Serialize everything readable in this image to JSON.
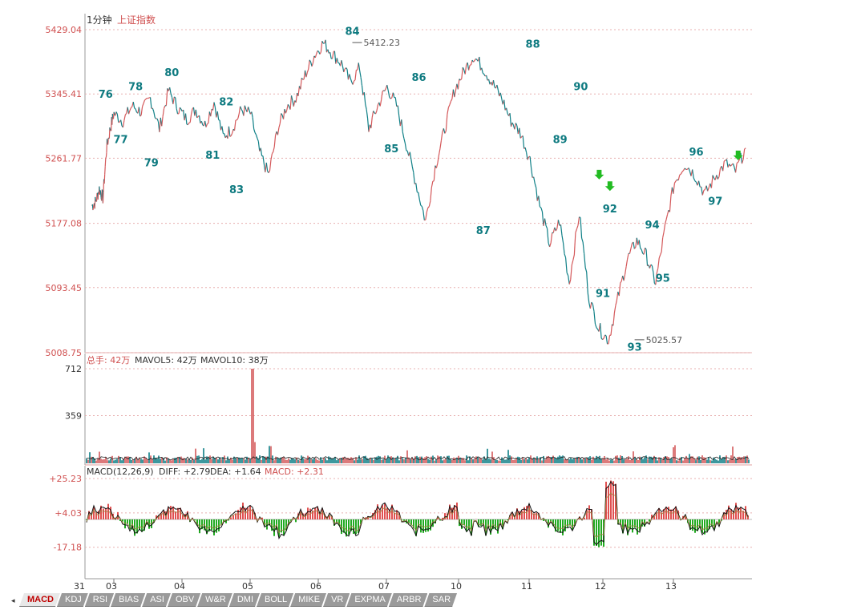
{
  "header": {
    "period": "1分钟",
    "instrument": "上证指数"
  },
  "price_axis": {
    "ticks": [
      "5429.04",
      "5345.41",
      "5261.77",
      "5177.08",
      "5093.45",
      "5008.75"
    ]
  },
  "volume_panel": {
    "label": "总手: 42万",
    "mavol5": "MAVOL5: 42万",
    "mavol10": "MAVOL10: 38万",
    "ticks": [
      "712",
      "359"
    ]
  },
  "macd_panel": {
    "label": "MACD(12,26,9)",
    "diff": "DIFF: +2.79",
    "dea": "DEA: +1.64",
    "macd": "MACD: +2.31",
    "ticks": [
      "+25.23",
      "+4.03",
      "-17.18"
    ]
  },
  "time_axis": {
    "labels": [
      "31",
      "03",
      "04",
      "05",
      "06",
      "07",
      "10",
      "11",
      "12",
      "13"
    ]
  },
  "indicator_tabs": [
    "MACD",
    "KDJ",
    "RSI",
    "BIAS",
    "ASI",
    "OBV",
    "W&R",
    "DMI",
    "BOLL",
    "MIKE",
    "VR",
    "EXPMA",
    "ARBR",
    "SAR"
  ],
  "colors": {
    "up": "#d4585a",
    "down": "#0e7f86",
    "price_axis_text": "#d05050",
    "wave_label": "#0e7a80",
    "macd_positive": "#e05050",
    "macd_negative": "#22aa22",
    "arrow": "#22bb22",
    "panel_border": "#e0a0a0"
  },
  "chart_data": {
    "type": "line",
    "title": "1分钟 上证指数",
    "ylim": [
      5008.75,
      5429.04
    ],
    "x": [
      "31",
      "03",
      "04",
      "05",
      "06",
      "07",
      "10",
      "11",
      "12",
      "13"
    ],
    "series": [
      {
        "values": [
          5200,
          5205,
          5222,
          5210,
          5275,
          5300,
          5320,
          5310,
          5330,
          5322,
          5340,
          5300,
          5350,
          5328,
          5312,
          5325,
          5305,
          5335,
          5290,
          5300,
          5325,
          5320,
          5270,
          5240,
          5300,
          5330,
          5340,
          5370,
          5395,
          5412,
          5398,
          5385,
          5360,
          5380,
          5300,
          5330,
          5355,
          5330,
          5280,
          5230,
          5180,
          5250,
          5300,
          5350,
          5375,
          5395,
          5380,
          5360,
          5340,
          5310,
          5295,
          5260,
          5200,
          5150,
          5180,
          5100,
          5190,
          5080,
          5040,
          5025,
          5080,
          5130,
          5155,
          5135,
          5100,
          5170,
          5230,
          5255,
          5240,
          5215,
          5238,
          5255,
          5245,
          5275
        ]
      }
    ],
    "wave_labels": [
      {
        "label": "76",
        "x": 0.7,
        "price": 5330,
        "pos": "above"
      },
      {
        "label": "77",
        "x": 1.1,
        "price": 5300,
        "pos": "below"
      },
      {
        "label": "78",
        "x": 1.32,
        "price": 5340,
        "pos": "above"
      },
      {
        "label": "79",
        "x": 1.55,
        "price": 5270,
        "pos": "below"
      },
      {
        "label": "80",
        "x": 1.85,
        "price": 5358,
        "pos": "above"
      },
      {
        "label": "81",
        "x": 2.45,
        "price": 5280,
        "pos": "below"
      },
      {
        "label": "82",
        "x": 2.65,
        "price": 5320,
        "pos": "above"
      },
      {
        "label": "83",
        "x": 2.8,
        "price": 5235,
        "pos": "below"
      },
      {
        "label": "84",
        "x": 4.5,
        "price": 5412,
        "pos": "above"
      },
      {
        "label": "85",
        "x": 5.07,
        "price": 5288,
        "pos": "below"
      },
      {
        "label": "86",
        "x": 5.45,
        "price": 5352,
        "pos": "above"
      },
      {
        "label": "87",
        "x": 6.35,
        "price": 5182,
        "pos": "below"
      },
      {
        "label": "88",
        "x": 7.05,
        "price": 5395,
        "pos": "above"
      },
      {
        "label": "89",
        "x": 7.42,
        "price": 5300,
        "pos": "below"
      },
      {
        "label": "90",
        "x": 7.7,
        "price": 5340,
        "pos": "above"
      },
      {
        "label": "91",
        "x": 8.0,
        "price": 5100,
        "pos": "below"
      },
      {
        "label": "92",
        "x": 8.1,
        "price": 5210,
        "pos": "below"
      },
      {
        "label": "93",
        "x": 8.45,
        "price": 5030,
        "pos": "below"
      },
      {
        "label": "94",
        "x": 8.7,
        "price": 5160,
        "pos": "above"
      },
      {
        "label": "95",
        "x": 8.85,
        "price": 5120,
        "pos": "below"
      },
      {
        "label": "96",
        "x": 9.3,
        "price": 5255,
        "pos": "above"
      },
      {
        "label": "97",
        "x": 9.55,
        "price": 5220,
        "pos": "below"
      }
    ],
    "price_annotations": [
      {
        "text": "5412.23",
        "x": 4.5,
        "price": 5412.23
      },
      {
        "text": "5025.57",
        "x": 8.45,
        "price": 5025.57
      }
    ],
    "arrows": [
      {
        "x": 7.95,
        "price": 5230
      },
      {
        "x": 8.1,
        "price": 5215
      },
      {
        "x": 9.85,
        "price": 5255
      }
    ]
  }
}
